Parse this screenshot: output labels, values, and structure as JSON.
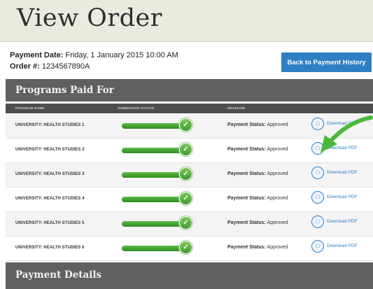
{
  "page_title": "View Order",
  "order_info": {
    "payment_date_label": "Payment Date:",
    "payment_date_value": "Friday, 1 January 2015 10:00 AM",
    "order_label": "Order #:",
    "order_value": "1234567890A"
  },
  "back_button_label": "Back to Payment History",
  "programs_section_title": "Programs Paid For",
  "table": {
    "columns": [
      "PROGRAM NAME",
      "SUBMISSION STATUS",
      "DEADLINE"
    ],
    "status_label": "Payment Status:",
    "download_label": "Download PDF",
    "rows": [
      {
        "program": "UNIVERSITY: HEALTH STUDIES 1",
        "status": "Approved",
        "download": "Download PDF"
      },
      {
        "program": "UNIVERSITY: HEALTH STUDIES 2",
        "status": "Approved",
        "download": "Download PDF"
      },
      {
        "program": "UNIVERSITY: HEALTH STUDIES 3",
        "status": "Approved",
        "download": "Download PDF"
      },
      {
        "program": "UNIVERSITY: HEALTH STUDIES 4",
        "status": "Approved",
        "download": "Download PDF"
      },
      {
        "program": "UNIVERSITY: HEALTH STUDIES 5",
        "status": "Approved",
        "download": "Download PDF"
      },
      {
        "program": "UNIVERSITY: HEALTH STUDIES 6",
        "status": "Approved",
        "download": "Download PDF"
      }
    ]
  },
  "payment_details_title": "Payment Details",
  "colors": {
    "header_bg": "#ebeadf",
    "section_bar": "#5f6061",
    "accent_blue": "#2f7fc4",
    "status_green": "#3f9b2e",
    "annotation_arrow": "#4ab83a"
  },
  "icons": {
    "check": "check-icon",
    "pdf": "pdf-icon",
    "annotation": "annotation-arrow"
  }
}
